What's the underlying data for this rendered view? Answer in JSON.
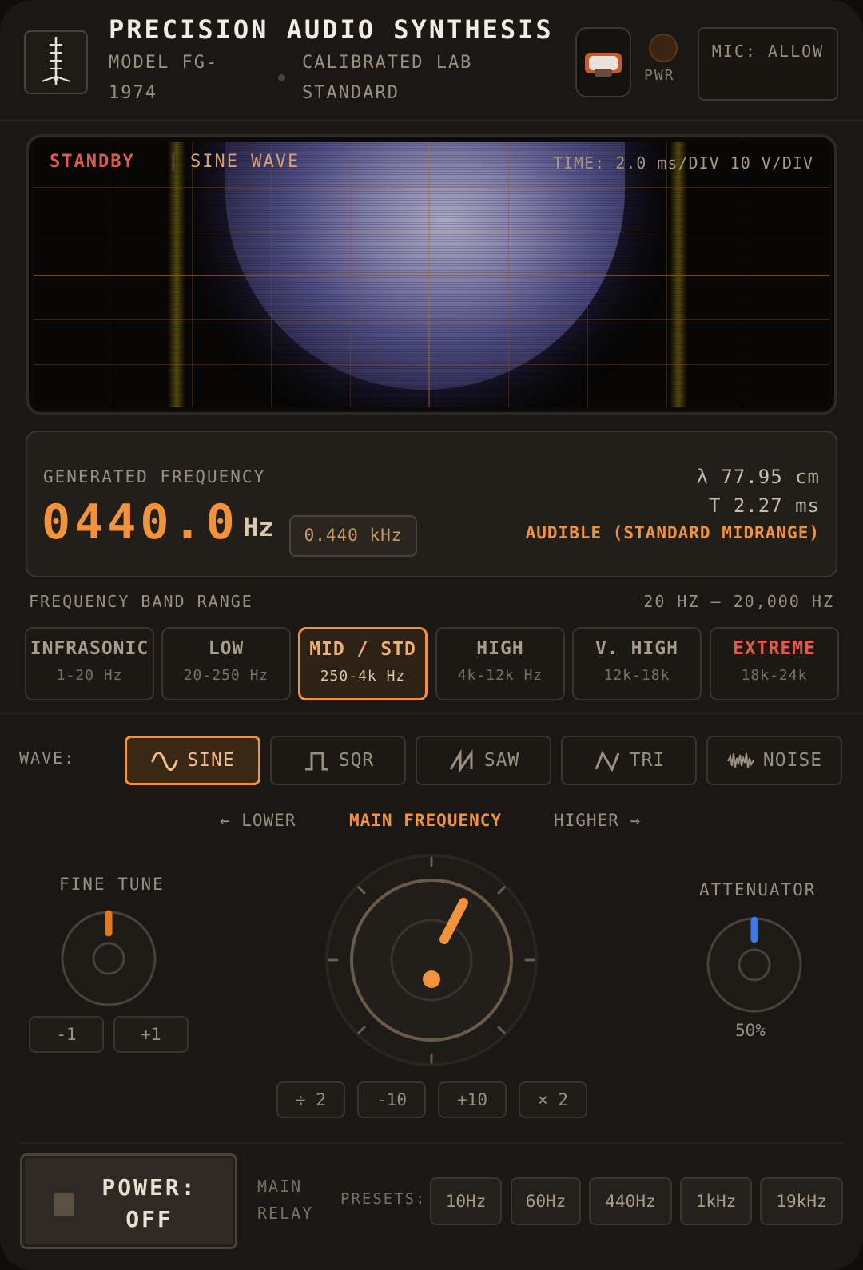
{
  "header": {
    "title": "PRECISION AUDIO SYNTHESIS",
    "model": "MODEL FG-1974",
    "calibration": "CALIBRATED LAB STANDARD",
    "pwr_label": "PWR",
    "mic_button": "MIC: ALLOW",
    "logo_icon": "antenna-tower-icon",
    "camera_icon": "webcam-icon"
  },
  "scope": {
    "status": "STANDBY",
    "separator": "|",
    "wave": "SINE WAVE",
    "timebase": "TIME: 2.0 ms/DIV  10 V/DIV",
    "status_color": "#e05a4a"
  },
  "frequency": {
    "label": "GENERATED FREQUENCY",
    "value": "0440.0",
    "unit": "Hz",
    "khz": "0.440 kHz",
    "wavelength": "λ 77.95 cm",
    "period": "T 2.27 ms",
    "classification": "AUDIBLE (STANDARD MIDRANGE)",
    "accent": "#f2923a"
  },
  "bands": {
    "label": "FREQUENCY BAND RANGE",
    "range": "20 HZ – 20,000 HZ",
    "items": [
      {
        "name": "INFRASONIC",
        "range": "1-20 Hz"
      },
      {
        "name": "LOW",
        "range": "20-250 Hz"
      },
      {
        "name": "MID / STD",
        "range": "250-4k Hz"
      },
      {
        "name": "HIGH",
        "range": "4k-12k Hz"
      },
      {
        "name": "V. HIGH",
        "range": "12k-18k"
      },
      {
        "name": "EXTREME",
        "range": "18k-24k"
      }
    ],
    "active_index": 2
  },
  "wave": {
    "label": "WAVE:",
    "options": [
      {
        "label": "SINE",
        "icon": "sine-wave-icon"
      },
      {
        "label": "SQR",
        "icon": "square-wave-icon"
      },
      {
        "label": "SAW",
        "icon": "sawtooth-wave-icon"
      },
      {
        "label": "TRI",
        "icon": "triangle-wave-icon"
      },
      {
        "label": "NOISE",
        "icon": "noise-wave-icon"
      }
    ],
    "active_index": 0
  },
  "controls": {
    "lower": "← LOWER",
    "main": "MAIN FREQUENCY",
    "higher": "HIGHER →",
    "fine_tune": "FINE TUNE",
    "fine_minus": "-1",
    "fine_plus": "+1",
    "attenuator": "ATTENUATOR",
    "attenuator_value": "50%",
    "main_buttons": [
      "÷ 2",
      "-10",
      "+10",
      "× 2"
    ],
    "fine_knob_color": "#e07a20",
    "attenuator_knob_color": "#3a7ae8"
  },
  "bottom": {
    "power": "POWER: OFF",
    "relay": "MAIN RELAY",
    "presets_label": "PRESETS:",
    "presets": [
      "10Hz",
      "60Hz",
      "440Hz",
      "1kHz",
      "19kHz"
    ]
  }
}
